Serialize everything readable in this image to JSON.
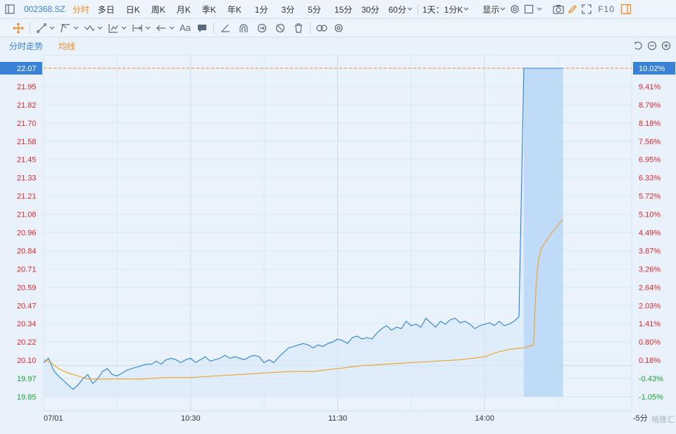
{
  "toolbar": {
    "symbol": "002368.SZ",
    "periods": [
      "分时",
      "多日",
      "日K",
      "周K",
      "月K",
      "季K",
      "年K",
      "1分",
      "3分",
      "5分",
      "15分",
      "30分",
      "60分"
    ],
    "active_period": "分时",
    "range_label": "1天：1分K",
    "display_label": "显示",
    "f10_label": "F10"
  },
  "tools": {
    "text_tool_label": "Aa"
  },
  "subtabs": {
    "time_trend": "分时走势",
    "avg_line": "均线"
  },
  "colors": {
    "price_line": "#2a7fd4",
    "avg_line": "#f0a020",
    "up": "#e0262b",
    "down": "#1aa33a",
    "ref_line": "#f08a1c",
    "highlight_box": "#3a82d6"
  },
  "chart_data": {
    "type": "line",
    "prev_close": 20.06,
    "ylim": [
      19.85,
      22.07
    ],
    "y_ticks": [
      "22.07",
      "21.95",
      "21.82",
      "21.70",
      "21.58",
      "21.45",
      "21.33",
      "21.21",
      "21.08",
      "20.96",
      "20.84",
      "20.71",
      "20.59",
      "20.47",
      "20.34",
      "20.22",
      "20.10",
      "19.97",
      "19.85"
    ],
    "pct_ticks": [
      "10.02%",
      "9.41%",
      "8.79%",
      "8.18%",
      "7.56%",
      "6.95%",
      "6.33%",
      "5.72%",
      "5.10%",
      "4.49%",
      "3.87%",
      "3.26%",
      "2.64%",
      "2.03%",
      "1.41%",
      "0.80%",
      "0.18%",
      "-0.43%",
      "-1.05%"
    ],
    "x_labels": [
      "07/01",
      "10:30",
      "11:30",
      "14:00"
    ],
    "x_tick_minutes": [
      0,
      60,
      120,
      180
    ],
    "x_last_label": "-5分",
    "watermark": "格隆汇",
    "series": [
      {
        "name": "分时",
        "minutes": [
          0,
          2,
          4,
          6,
          8,
          10,
          12,
          14,
          16,
          18,
          20,
          22,
          24,
          26,
          28,
          30,
          32,
          34,
          36,
          38,
          40,
          42,
          44,
          46,
          48,
          50,
          52,
          54,
          56,
          58,
          60,
          62,
          64,
          66,
          68,
          70,
          72,
          74,
          76,
          78,
          80,
          82,
          84,
          86,
          88,
          90,
          92,
          94,
          96,
          98,
          100,
          102,
          104,
          106,
          108,
          110,
          112,
          114,
          116,
          118,
          120,
          122,
          124,
          126,
          128,
          130,
          132,
          134,
          136,
          138,
          140,
          142,
          144,
          146,
          148,
          150,
          152,
          154,
          156,
          158,
          160,
          162,
          164,
          166,
          168,
          170,
          172,
          174,
          176,
          178,
          180,
          182,
          184,
          186,
          188,
          190,
          192,
          194,
          196,
          198,
          200,
          201,
          202,
          203,
          204,
          206,
          208,
          210,
          212
        ],
        "values": [
          20.08,
          20.11,
          20.03,
          19.99,
          19.96,
          19.93,
          19.9,
          19.93,
          19.97,
          20.0,
          19.94,
          19.97,
          20.02,
          20.04,
          20.0,
          19.99,
          20.01,
          20.03,
          20.04,
          20.05,
          20.06,
          20.07,
          20.07,
          20.09,
          20.07,
          20.1,
          20.11,
          20.1,
          20.08,
          20.1,
          20.11,
          20.08,
          20.1,
          20.12,
          20.09,
          20.1,
          20.11,
          20.13,
          20.11,
          20.12,
          20.11,
          20.1,
          20.12,
          20.13,
          20.12,
          20.08,
          20.1,
          20.08,
          20.12,
          20.15,
          20.18,
          20.19,
          20.2,
          20.21,
          20.2,
          20.18,
          20.2,
          20.19,
          20.21,
          20.22,
          20.24,
          20.23,
          20.21,
          20.25,
          20.26,
          20.24,
          20.25,
          20.24,
          20.28,
          20.31,
          20.33,
          20.3,
          20.32,
          20.31,
          20.36,
          20.33,
          20.34,
          20.32,
          20.38,
          20.35,
          20.32,
          20.36,
          20.34,
          20.37,
          20.38,
          20.35,
          20.36,
          20.34,
          20.31,
          20.33,
          20.34,
          20.35,
          20.33,
          20.36,
          20.33,
          20.34,
          20.36,
          20.39,
          22.07,
          22.07,
          22.07,
          22.07,
          22.07,
          22.07,
          22.07,
          22.07,
          22.07,
          22.07,
          22.07
        ]
      },
      {
        "name": "均线",
        "minutes": [
          0,
          3,
          6,
          10,
          14,
          18,
          24,
          30,
          40,
          50,
          60,
          70,
          80,
          90,
          100,
          110,
          115,
          120,
          125,
          130,
          140,
          150,
          160,
          170,
          180,
          185,
          190,
          196,
          200,
          201,
          202,
          203,
          205,
          207,
          209,
          211,
          212
        ],
        "values": [
          20.1,
          20.08,
          20.04,
          20.01,
          19.99,
          19.97,
          19.97,
          19.97,
          19.97,
          19.98,
          19.98,
          19.99,
          20.0,
          20.01,
          20.02,
          20.02,
          20.03,
          20.04,
          20.05,
          20.06,
          20.07,
          20.08,
          20.09,
          20.1,
          20.12,
          20.15,
          20.17,
          20.18,
          20.2,
          20.6,
          20.78,
          20.85,
          20.9,
          20.95,
          20.99,
          21.03,
          21.05
        ]
      }
    ]
  }
}
